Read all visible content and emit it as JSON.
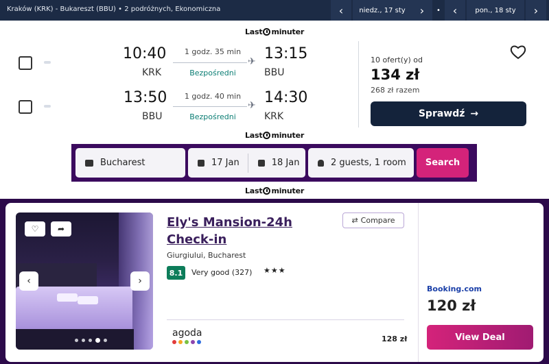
{
  "flight_bar": {
    "route": "Kraków (KRK) - Bukareszt (BBU)",
    "details": "2 podróżnych, Ekonomiczna",
    "depart_date": "niedz., 17 sty",
    "return_date": "pon., 18 sty",
    "prev_icon": "chevron-left-icon",
    "next_icon": "chevron-right-icon"
  },
  "logo_text_left": "Last",
  "logo_text_right": "minuter",
  "flight": {
    "legs": [
      {
        "dep_time": "10:40",
        "dep_code": "KRK",
        "duration": "1 godz. 35 min",
        "stops": "Bezpośredni",
        "arr_time": "13:15",
        "arr_code": "BBU"
      },
      {
        "dep_time": "13:50",
        "dep_code": "BBU",
        "duration": "1 godz. 40 min",
        "stops": "Bezpośredni",
        "arr_time": "14:30",
        "arr_code": "KRK"
      }
    ],
    "offers": "10 ofert(y) od",
    "price": "134 zł",
    "total": "268 zł razem",
    "check_label": "Sprawdź",
    "check_arrow": "→"
  },
  "hotel_search": {
    "destination": "Bucharest",
    "checkin": "17 Jan",
    "checkout": "18 Jan",
    "guests": "2 guests, 1 room",
    "search_label": "Search"
  },
  "hotel": {
    "name": "Ely's Mansion-24h Check-in",
    "compare_label": "Compare",
    "location": "Giurgiului, Bucharest",
    "rating": "8.1",
    "rating_text": "Very good (327)",
    "stars": "★★★",
    "alt_provider": "agoda",
    "alt_price": "128 zł",
    "provider": "Booking.com",
    "price": "120 zł",
    "deal_label": "View Deal",
    "prev": "‹",
    "next": "›"
  },
  "colors": {
    "navy": "#1c2b45",
    "purple": "#3b0a5e",
    "pink": "#d4237a",
    "green": "#0d7d5a",
    "teal": "#0a7d73"
  }
}
